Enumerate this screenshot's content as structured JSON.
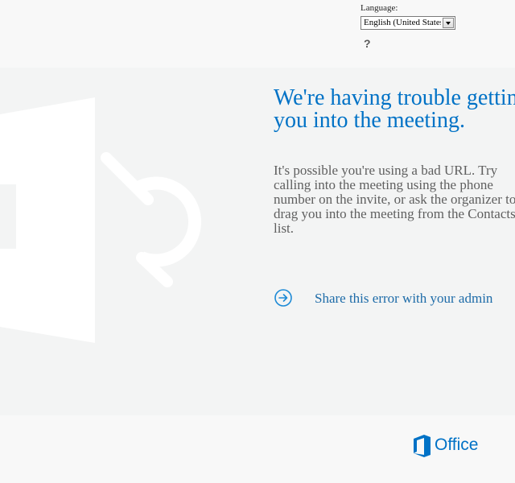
{
  "header": {
    "language_label": "Language:",
    "language_selected": "English (United States)",
    "help_glyph": "?"
  },
  "main": {
    "headline_line1": "We're having trouble getting",
    "headline_line2": "you into the meeting.",
    "body_lines": [
      "It's possible you're using a bad URL. Try",
      "calling into the meeting using the phone",
      "number on the invite, or ask the organizer to",
      "drag you into the meeting from the Contacts",
      "list."
    ],
    "share_label": "Share this error with your admin",
    "share_icon": "arrow-circle-right-icon",
    "background_icon": "lync-logo-icon"
  },
  "footer": {
    "brand_name": "Office",
    "brand_icon": "office-logo-icon"
  },
  "colors": {
    "accent_blue": "#0072c6",
    "link_blue": "#1d6ba8",
    "body_gray": "#5f5f5f",
    "band_gray": "#f3f4f4"
  }
}
